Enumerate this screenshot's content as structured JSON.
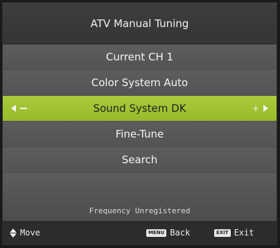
{
  "menu": {
    "title": "ATV Manual Tuning",
    "items": [
      {
        "label": "Current CH 1"
      },
      {
        "label": "Color System Auto"
      },
      {
        "label": "Sound System DK"
      },
      {
        "label": "Fine-Tune"
      },
      {
        "label": "Search"
      },
      {
        "label": ""
      }
    ],
    "selected_index": 2,
    "status": "Frequency Unregistered"
  },
  "footer": {
    "move_label": "Move",
    "back_key": "MENU",
    "back_label": "Back",
    "exit_key": "EXIT",
    "exit_label": "Exit"
  },
  "colors": {
    "highlight": "#a3c435",
    "row": "#595959",
    "header": "#3b3b3b",
    "footer": "#2c2c2c"
  },
  "icons": {
    "left": "left-arrow-icon",
    "minus": "minus-icon",
    "plus": "plus-icon",
    "right": "right-arrow-icon",
    "updown": "up-down-arrows-icon"
  }
}
